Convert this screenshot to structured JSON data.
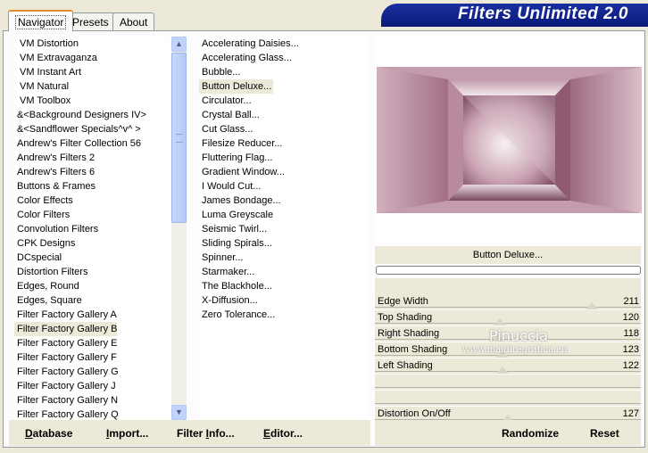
{
  "tabs": [
    {
      "label": "Navigator"
    },
    {
      "label": "Presets"
    },
    {
      "label": "About"
    }
  ],
  "banner": {
    "title": "Filters Unlimited 2.0"
  },
  "categories": [
    "VM Distortion",
    "VM Extravaganza",
    "VM Instant Art",
    "VM Natural",
    "VM Toolbox",
    "&<Background Designers IV>",
    "&<Sandflower Specials^v^ >",
    "Andrew's Filter Collection 56",
    "Andrew's Filters 2",
    "Andrew's Filters 6",
    "Buttons & Frames",
    "Color Effects",
    "Color Filters",
    "Convolution Filters",
    "CPK Designs",
    "DCspecial",
    "Distortion Filters",
    "Edges, Round",
    "Edges, Square",
    "Filter Factory Gallery A",
    "Filter Factory Gallery B",
    "Filter Factory Gallery E",
    "Filter Factory Gallery F",
    "Filter Factory Gallery G",
    "Filter Factory Gallery J",
    "Filter Factory Gallery N",
    "Filter Factory Gallery Q"
  ],
  "selected_category": "Filter Factory Gallery B",
  "filters": [
    "Accelerating Daisies...",
    "Accelerating Glass...",
    "Bubble...",
    "Button Deluxe...",
    "Circulator...",
    "Crystal Ball...",
    "Cut Glass...",
    "Filesize Reducer...",
    "Fluttering Flag...",
    "Gradient Window...",
    "I Would Cut...",
    "James Bondage...",
    "Luma Greyscale",
    "Seismic Twirl...",
    "Sliding Spirals...",
    "Spinner...",
    "Starmaker...",
    "The Blackhole...",
    "X-Diffusion...",
    "Zero Tolerance..."
  ],
  "selected_filter": "Button Deluxe...",
  "preview": {
    "filter_name": "Button Deluxe...",
    "progress": 0
  },
  "params": [
    {
      "label": "Edge Width",
      "value": "211",
      "level": 0.83
    },
    {
      "label": "Top Shading",
      "value": "120",
      "level": 0.47
    },
    {
      "label": "Right Shading",
      "value": "118",
      "level": 0.46
    },
    {
      "label": "Bottom Shading",
      "value": "123",
      "level": 0.48
    },
    {
      "label": "Left Shading",
      "value": "122",
      "level": 0.48
    },
    {
      "label": "",
      "value": "",
      "level": null
    },
    {
      "label": "",
      "value": "",
      "level": null
    },
    {
      "label": "Distortion On/Off",
      "value": "127",
      "level": 0.5
    }
  ],
  "watermark": {
    "line1": "Pinuccia",
    "line2": "www.maidiregrafica.eu"
  },
  "buttons": {
    "database": {
      "u": "D",
      "rest": "atabase"
    },
    "import": {
      "u": "I",
      "rest": "mport..."
    },
    "filter_info": {
      "pre": "Filter ",
      "u": "I",
      "rest": "nfo..."
    },
    "editor": {
      "u": "E",
      "rest": "ditor..."
    },
    "randomize": "Randomize",
    "reset": "Reset"
  },
  "colors": {
    "banner": "#0a1a7a",
    "preview_mauve": "#a76f85",
    "tab_highlight": "#e68b2c"
  }
}
